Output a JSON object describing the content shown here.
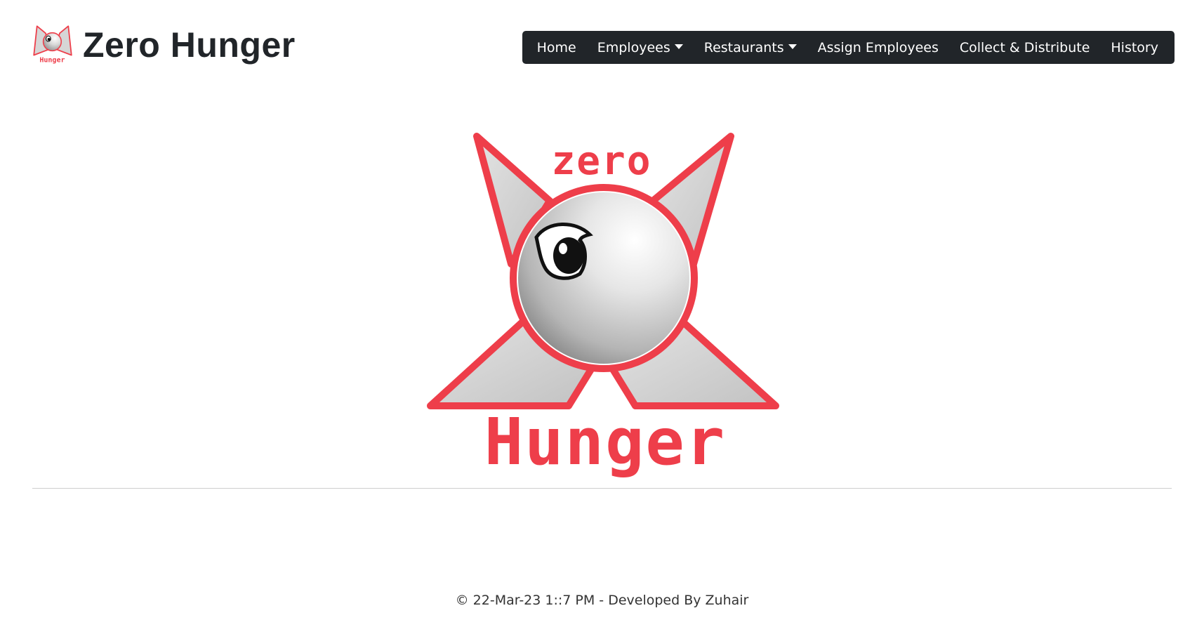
{
  "brand": {
    "title": "Zero Hunger",
    "logo_icon": "zero-hunger-logo"
  },
  "nav": {
    "items": [
      {
        "label": "Home",
        "dropdown": false
      },
      {
        "label": "Employees",
        "dropdown": true
      },
      {
        "label": "Restaurants",
        "dropdown": true
      },
      {
        "label": "Assign Employees",
        "dropdown": false
      },
      {
        "label": "Collect & Distribute",
        "dropdown": false
      },
      {
        "label": "History",
        "dropdown": false
      }
    ]
  },
  "hero": {
    "logo_icon": "zero-hunger-logo",
    "logo_text_top": "zero",
    "logo_text_bottom": "Hunger"
  },
  "footer": {
    "text": "© 22-Mar-23 1::7 PM - Developed By Zuhair"
  },
  "colors": {
    "accent": "#ee3e4a",
    "navbar_bg": "#212529",
    "text": "#212529"
  }
}
